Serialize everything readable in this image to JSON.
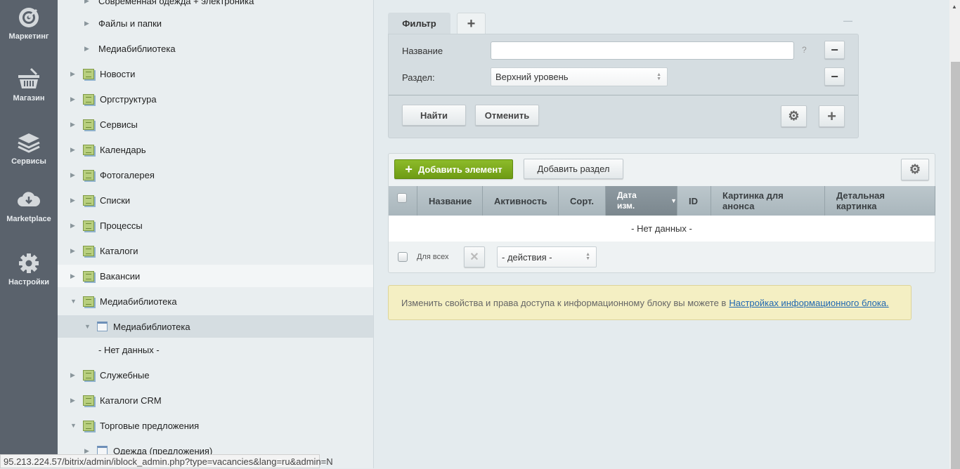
{
  "leftbar": {
    "items": [
      {
        "label": "Маркетинг",
        "icon": "target-icon"
      },
      {
        "label": "Магазин",
        "icon": "basket-icon"
      },
      {
        "label": "Сервисы",
        "icon": "layers-icon"
      },
      {
        "label": "Marketplace",
        "icon": "cloud-download-icon"
      },
      {
        "label": "Настройки",
        "icon": "gear-icon"
      }
    ]
  },
  "tree": {
    "items": [
      {
        "label": "Современная одежда + электроника",
        "type": "section",
        "expanded": false
      },
      {
        "label": "Файлы и папки",
        "type": "section",
        "expanded": false
      },
      {
        "label": "Медиабиблиотека",
        "type": "section",
        "expanded": false
      },
      {
        "label": "Новости",
        "type": "type",
        "expanded": false
      },
      {
        "label": "Оргструктура",
        "type": "type",
        "expanded": false
      },
      {
        "label": "Сервисы",
        "type": "type",
        "expanded": false
      },
      {
        "label": "Календарь",
        "type": "type",
        "expanded": false
      },
      {
        "label": "Фотогалерея",
        "type": "type",
        "expanded": false
      },
      {
        "label": "Списки",
        "type": "type",
        "expanded": false
      },
      {
        "label": "Процессы",
        "type": "type",
        "expanded": false
      },
      {
        "label": "Каталоги",
        "type": "type",
        "expanded": false
      },
      {
        "label": "Вакансии",
        "type": "type",
        "expanded": false
      },
      {
        "label": "Медиабиблиотека",
        "type": "type",
        "expanded": true
      },
      {
        "label": "Медиабиблиотека",
        "type": "iblock",
        "expanded": true
      },
      {
        "label": "- Нет данных -",
        "type": "empty"
      },
      {
        "label": "Служебные",
        "type": "type",
        "expanded": false
      },
      {
        "label": "Каталоги CRM",
        "type": "type",
        "expanded": false
      },
      {
        "label": "Торговые предложения",
        "type": "type",
        "expanded": true
      },
      {
        "label": "Одежда (предложения)",
        "type": "iblock",
        "expanded": false
      }
    ]
  },
  "filter": {
    "tab": "Фильтр",
    "add_tab": "+",
    "collapse": "—",
    "name_label": "Название",
    "name_value": "",
    "help": "?",
    "section_label": "Раздел:",
    "section_value": "Верхний уровень",
    "remove": "−",
    "find": "Найти",
    "cancel": "Отменить",
    "add": "+"
  },
  "grid": {
    "add_element": "Добавить элемент",
    "add_section": "Добавить раздел",
    "columns": [
      "Название",
      "Активность",
      "Сорт.",
      "Дата изм.",
      "ID",
      "Картинка для анонса",
      "Детальная картинка"
    ],
    "sorted_column": "Дата изм.",
    "empty": "- Нет данных -",
    "for_all": "Для всех",
    "actions": "- действия -"
  },
  "note": {
    "text": "Изменить свойства и права доступа к информационному блоку вы можете в",
    "link": "Настройках информационного блока."
  },
  "status_url": "95.213.224.57/bitrix/admin/iblock_admin.php?type=vacancies&lang=ru&admin=N",
  "colors": {
    "sidebar": "#5a626c",
    "add_button": "#7aa51d",
    "note_bg": "#f4efc3",
    "link": "#2067b0"
  }
}
